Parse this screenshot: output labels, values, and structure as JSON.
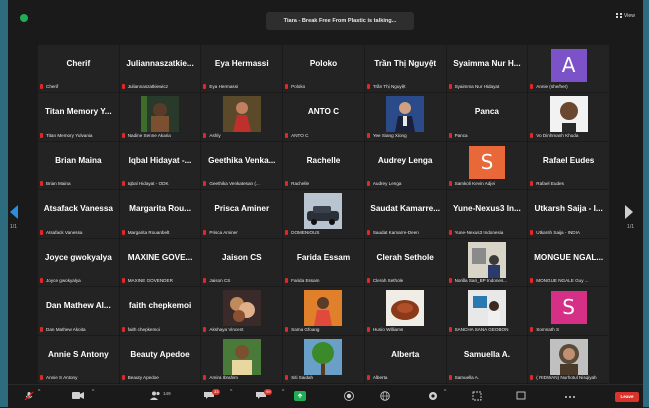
{
  "window": {
    "title": "Tiara - Break Free From Plastic is talking...",
    "view_label": "View"
  },
  "pagination": {
    "left": "1/1",
    "right": "1/1"
  },
  "colors": {
    "accent_blue": "#2b8de0",
    "mic_muted": "#e02828",
    "leave_red": "#d9342b",
    "frame": "#2d6b7e"
  },
  "participants": [
    {
      "display": "Cherif",
      "caption": "Cherif",
      "kind": "name"
    },
    {
      "display": "Juliannaszatkie...",
      "caption": "Juliannaszatkiewicz",
      "kind": "name"
    },
    {
      "display": "Eya Hermassi",
      "caption": "Eya Hermassi",
      "kind": "name"
    },
    {
      "display": "Poloko",
      "caption": "Poloko",
      "kind": "name"
    },
    {
      "display": "Trần Thị Nguyệt",
      "caption": "Trần Thị Nguyệt",
      "kind": "name"
    },
    {
      "display": "Syaimma Nur H...",
      "caption": "Syaimma Nur Hidayat",
      "kind": "name"
    },
    {
      "display": "A",
      "caption": "Annie (she/her)",
      "kind": "avatar",
      "avatar_color": "#7b52c7"
    },
    {
      "display": "Titan Memory Y...",
      "caption": "Titan Memory Yulvania",
      "kind": "name"
    },
    {
      "display": "",
      "caption": "Nadine Senne Akaria",
      "kind": "photo",
      "icon": "woman-portrait-photo"
    },
    {
      "display": "",
      "caption": "Ashly",
      "kind": "photo",
      "icon": "woman-red-dress-photo"
    },
    {
      "display": "ANTO C",
      "caption": "ANTO C",
      "kind": "name"
    },
    {
      "display": "",
      "caption": "Yee Siang Xiong",
      "kind": "photo",
      "icon": "man-suit-photo"
    },
    {
      "display": "Panca",
      "caption": "Panca",
      "kind": "name"
    },
    {
      "display": "",
      "caption": "Vo Dinhmanh Khuda",
      "kind": "photo",
      "icon": "smiling-man-photo"
    },
    {
      "display": "Brian Maina",
      "caption": "Brian Maina",
      "kind": "name"
    },
    {
      "display": "Iqbal Hidayat -...",
      "caption": "Iqbal Hidayat - ODK",
      "kind": "name"
    },
    {
      "display": "Geethika Venka...",
      "caption": "Geethika Venkatesan (...",
      "kind": "name"
    },
    {
      "display": "Rachelle",
      "caption": "Rachelle",
      "kind": "name"
    },
    {
      "display": "Audrey Lenga",
      "caption": "Audrey Lenga",
      "kind": "name"
    },
    {
      "display": "S",
      "caption": "Samkoli Kevin Adjei",
      "kind": "avatar",
      "avatar_color": "#e8683a"
    },
    {
      "display": "Rafael Eudes",
      "caption": "Rafael Eudes",
      "kind": "name"
    },
    {
      "display": "Atsafack Vanessa",
      "caption": "Atsafack Vanessa",
      "kind": "name"
    },
    {
      "display": "Margarita Rou...",
      "caption": "Margarita Rouanbelt",
      "kind": "name"
    },
    {
      "display": "Prisca Aminer",
      "caption": "Prisca Aminer",
      "kind": "name"
    },
    {
      "display": "",
      "caption": "DOMENIOUS",
      "kind": "photo",
      "icon": "car-photo"
    },
    {
      "display": "Saudat Kamarre...",
      "caption": "Saudat Kamarre-Deen",
      "kind": "name"
    },
    {
      "display": "Yune-Nexus3 In...",
      "caption": "Yune-Nexus3 Indonesia",
      "kind": "name"
    },
    {
      "display": "Utkarsh Saija - I...",
      "caption": "Utkarsh Saija - INDIA",
      "kind": "name"
    },
    {
      "display": "Joyce gwokyalya",
      "caption": "Joyce gwokyalya",
      "kind": "name"
    },
    {
      "display": "MAXINE GOVE...",
      "caption": "MAXINE GOVENDER",
      "kind": "name"
    },
    {
      "display": "Jaison CS",
      "caption": "Jaison CS",
      "kind": "name"
    },
    {
      "display": "Farida Essam",
      "caption": "Farida Essam",
      "kind": "name"
    },
    {
      "display": "Clerah Sethole",
      "caption": "Clerah Sethole",
      "kind": "name"
    },
    {
      "display": "",
      "caption": "Norilla Sari_BP Indones...",
      "kind": "photo",
      "icon": "room-video-feed"
    },
    {
      "display": "MONGUE NGAL...",
      "caption": "MONGUE NGALE Guy ...",
      "kind": "name"
    },
    {
      "display": "Dan Mathew Al...",
      "caption": "Dan Mathew Akoita",
      "kind": "name"
    },
    {
      "display": "faith chepkemoi",
      "caption": "faith chepkemoi",
      "kind": "name"
    },
    {
      "display": "",
      "caption": "Akshaya Vincent",
      "kind": "photo",
      "icon": "floral-art-photo"
    },
    {
      "display": "",
      "caption": "Sama Gfoang",
      "kind": "photo",
      "icon": "woman-orange-photo"
    },
    {
      "display": "",
      "caption": "Hunio Williams",
      "kind": "photo",
      "icon": "food-plate-photo"
    },
    {
      "display": "",
      "caption": "SANCHA SANA GEOBON",
      "kind": "photo",
      "icon": "desk-video-feed"
    },
    {
      "display": "S",
      "caption": "Somnath S",
      "kind": "avatar",
      "avatar_color": "#d62f86"
    },
    {
      "display": "Annie S Antony",
      "caption": "Annie S Antony",
      "kind": "name"
    },
    {
      "display": "Beauty Apedoe",
      "caption": "Beauty Apedoe",
      "kind": "name"
    },
    {
      "display": "",
      "caption": "Amira Ibrahim",
      "kind": "photo",
      "icon": "man-green-bg-photo"
    },
    {
      "display": "",
      "caption": "Siti Saidah",
      "kind": "photo",
      "icon": "tree-photo"
    },
    {
      "display": "Alberta",
      "caption": "Alberta",
      "kind": "name"
    },
    {
      "display": "Samuella A.",
      "caption": "Samuella A.",
      "kind": "name"
    },
    {
      "display": "",
      "caption": "( RIDWAN) Nurhotul Nisqiyah",
      "kind": "photo",
      "icon": "woman-hijab-photo"
    }
  ],
  "toolbar": {
    "participants_count": "149",
    "chat_badge": "33",
    "reactions_badge": "99",
    "leave_label": "Leave"
  }
}
